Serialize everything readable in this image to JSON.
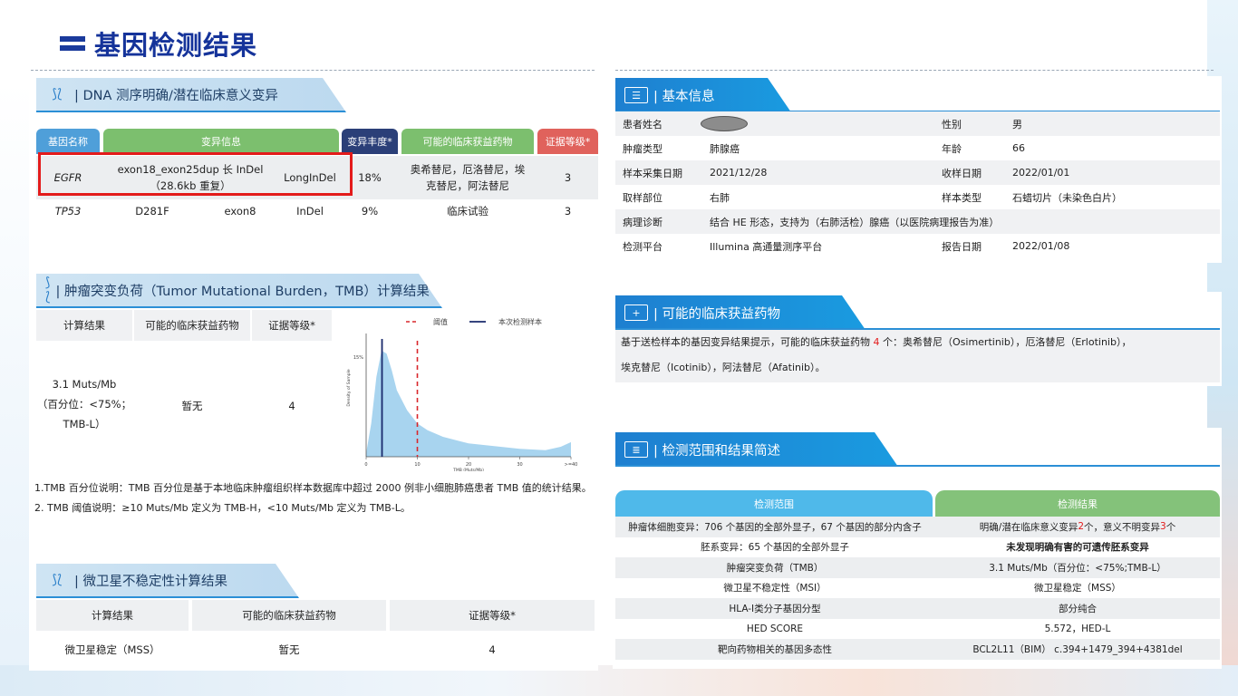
{
  "page_title": "基因检测结果",
  "dna_section": {
    "title": "DNA 测序明确/潜在临床意义变异",
    "headers": [
      "基因名称",
      "变异信息",
      "变异丰度*",
      "可能的临床获益药物",
      "证据等级*"
    ],
    "rows": [
      {
        "gene": "EGFR",
        "variant": "exon18_exon25dup 长 InDel（28.6kb 重复）",
        "type": "LongInDel",
        "abundance": "18%",
        "drugs": "奥希替尼，厄洛替尼，埃克替尼，阿法替尼",
        "evidence": "3"
      },
      {
        "gene": "TP53",
        "variant": "D281F",
        "exon": "exon8",
        "type": "InDel",
        "abundance": "9%",
        "drugs": "临床试验",
        "evidence": "3"
      }
    ]
  },
  "tmb_section": {
    "title": "肿瘤突变负荷（Tumor Mutational Burden，TMB）计算结果",
    "headers": [
      "计算结果",
      "可能的临床获益药物",
      "证据等级*"
    ],
    "result_lines": [
      "3.1 Muts/Mb",
      "（百分位：<75%；",
      "TMB-L）"
    ],
    "drug": "暂无",
    "evidence": "4",
    "legend": {
      "threshold": "阈值",
      "sample": "本次检测样本"
    },
    "notes": [
      "1.TMB 百分位说明：TMB 百分位是基于本地临床肿瘤组织样本数据库中超过 2000 例非小细胞肺癌患者 TMB 值的统计结果。",
      "2. TMB 阈值说明：≥10 Muts/Mb 定义为 TMB-H，<10 Muts/Mb 定义为 TMB-L。"
    ]
  },
  "chart_data": {
    "type": "area",
    "xlabel": "TMB (Muts/Mb)",
    "ylabel": "Density of Sample",
    "x_ticks": [
      "0",
      "10",
      "20",
      "30",
      ">=40"
    ],
    "y_ticks": [
      "15%"
    ],
    "xlim": [
      0,
      40
    ],
    "threshold": 10,
    "sample_value": 3.1,
    "x": [
      0,
      1,
      2,
      3,
      4,
      5,
      6,
      8,
      10,
      12,
      15,
      20,
      25,
      30,
      35,
      38,
      40
    ],
    "density": [
      0.5,
      5,
      12,
      16,
      15.5,
      13,
      10,
      7,
      5,
      4,
      3,
      2,
      1.6,
      1.2,
      1.0,
      1.5,
      2.2
    ],
    "colors": {
      "area": "#a8d4ef",
      "threshold": "#d9262b",
      "sample": "#1a2a6c"
    }
  },
  "msi_section": {
    "title": "微卫星不稳定性计算结果",
    "headers": [
      "计算结果",
      "可能的临床获益药物",
      "证据等级*"
    ],
    "row": [
      "微卫星稳定（MSS）",
      "暂无",
      "4"
    ]
  },
  "basic_info": {
    "title": "基本信息",
    "rows": [
      {
        "k1": "患者姓名",
        "v1": "",
        "k2": "性别",
        "v2": "男"
      },
      {
        "k1": "肿瘤类型",
        "v1": "肺腺癌",
        "k2": "年龄",
        "v2": "66"
      },
      {
        "k1": "样本采集日期",
        "v1": "2021/12/28",
        "k2": "收样日期",
        "v2": "2022/01/01"
      },
      {
        "k1": "取样部位",
        "v1": "右肺",
        "k2": "样本类型",
        "v2": "石蜡切片（未染色白片）"
      },
      {
        "k1": "病理诊断",
        "v1": "结合 HE 形态，支持为（右肺活检）腺癌（以医院病理报告为准）",
        "k2": "",
        "v2": ""
      },
      {
        "k1": "检测平台",
        "v1": "Illumina 高通量测序平台",
        "k2": "报告日期",
        "v2": "2022/01/08"
      }
    ]
  },
  "drugs_section": {
    "title": "可能的临床获益药物",
    "line1_pre": "基于送检样本的基因变异结果提示，可能的临床获益药物 ",
    "count": "4",
    "line1_post": " 个：奥希替尼（Osimertinib），厄洛替尼（Erlotinib），",
    "line2": "埃克替尼（Icotinib），阿法替尼（Afatinib）。"
  },
  "summary_section": {
    "title": "检测范围和结果简述",
    "headers": [
      "检测范围",
      "检测结果"
    ],
    "rows": [
      {
        "scope": "肿瘤体细胞变异：706 个基因的全部外显子，67 个基因的部分内含子",
        "result_pre": "明确/潜在临床意义变异 ",
        "n1": "2",
        "result_mid": " 个，意义不明变异 ",
        "n2": "3",
        "result_post": " 个"
      },
      {
        "scope": "胚系变异：65 个基因的全部外显子",
        "result": "未发现明确有害的可遗传胚系变异"
      },
      {
        "scope": "肿瘤突变负荷（TMB）",
        "result": "3.1 Muts/Mb（百分位：<75%;TMB-L）"
      },
      {
        "scope": "微卫星不稳定性（MSI）",
        "result": "微卫星稳定（MSS）"
      },
      {
        "scope": "HLA-Ⅰ类分子基因分型",
        "result": "部分纯合"
      },
      {
        "scope": "HED SCORE",
        "result": "5.572，HED-L"
      },
      {
        "scope": "靶向药物相关的基因多态性",
        "result": "BCL2L11（BIM） c.394+1479_394+4381del"
      }
    ]
  }
}
